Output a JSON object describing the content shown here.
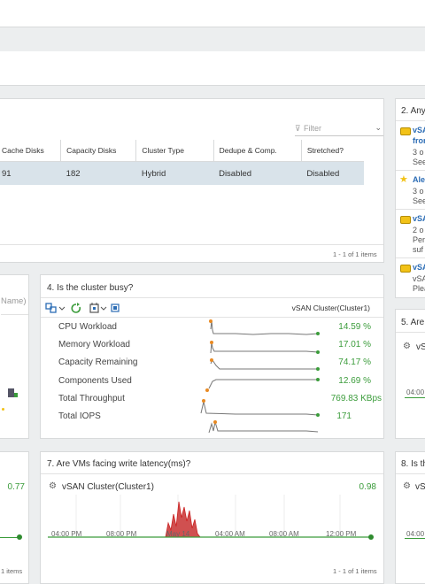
{
  "cluster_table": {
    "filter_placeholder": "Filter",
    "columns": [
      "Cache Disks",
      "Capacity Disks",
      "Cluster Type",
      "Dedupe & Comp.",
      "Stretched?"
    ],
    "row": [
      "91",
      "182",
      "Hybrid",
      "Disabled",
      "Disabled"
    ],
    "footer": "1 - 1 of 1 items"
  },
  "alerts": {
    "title": "2. Any",
    "items": [
      {
        "title": "vSA",
        "lines": [
          "fron",
          "3 o",
          "See"
        ]
      },
      {
        "title": "Ale",
        "lines": [
          "3 o",
          "See"
        ]
      },
      {
        "title": "vSA",
        "lines": [
          "2 o",
          "Per",
          "suf"
        ]
      },
      {
        "title": "vSA",
        "lines": [
          "vSA",
          "Plea"
        ]
      }
    ]
  },
  "left_panel": {
    "name_placeholder": "Name)"
  },
  "busy": {
    "title": "4. Is the cluster busy?",
    "entity": "vSAN Cluster(Cluster1)",
    "metrics": [
      {
        "label": "CPU Workload",
        "value": "14.59 %"
      },
      {
        "label": "Memory Workload",
        "value": "17.01 %"
      },
      {
        "label": "Capacity Remaining",
        "value": "74.17 %"
      },
      {
        "label": "Components Used",
        "value": "12.69 %"
      },
      {
        "label": "Total Throughput",
        "value": "769.83 KBps"
      },
      {
        "label": "Total IOPS",
        "value": "171"
      }
    ]
  },
  "right_panel_5": {
    "title": "5. Are",
    "entity": "vS",
    "tick": "04:00"
  },
  "left_panel_bottom": {
    "value": "0.77"
  },
  "latency": {
    "title": "7. Are VMs facing write latency(ms)?",
    "entity": "vSAN Cluster(Cluster1)",
    "value": "0.98",
    "ticks": [
      "04:00 PM",
      "08:00 PM",
      "May 14",
      "04:00 AM",
      "08:00 AM",
      "12:00 PM"
    ],
    "footer": "1 - 1 of 1 items"
  },
  "right_panel_8": {
    "title": "8. Is th",
    "entity": "vSA",
    "tick": "04:00"
  },
  "bottom_left_footer": "1 items"
}
